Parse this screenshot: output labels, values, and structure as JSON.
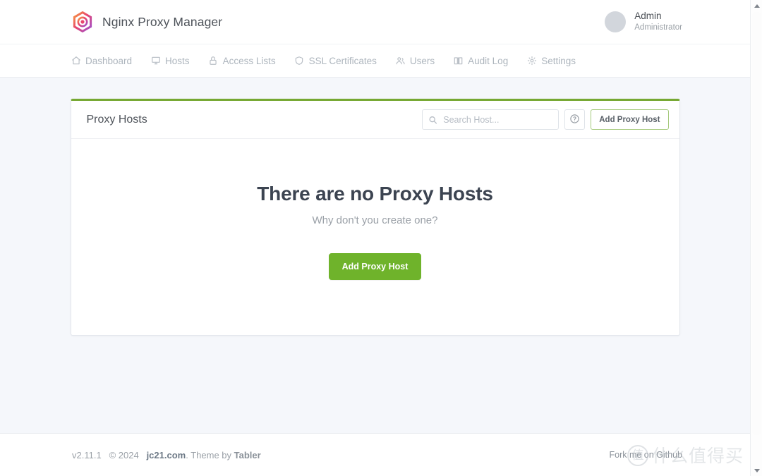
{
  "header": {
    "brand_title": "Nginx Proxy Manager",
    "logo_icon": "hexagon-target-logo",
    "user": {
      "name": "Admin",
      "role": "Administrator",
      "avatar_icon": "avatar"
    }
  },
  "nav": {
    "items": [
      {
        "label": "Dashboard",
        "icon": "home-icon"
      },
      {
        "label": "Hosts",
        "icon": "monitor-icon"
      },
      {
        "label": "Access Lists",
        "icon": "lock-icon"
      },
      {
        "label": "SSL Certificates",
        "icon": "shield-icon"
      },
      {
        "label": "Users",
        "icon": "users-icon"
      },
      {
        "label": "Audit Log",
        "icon": "book-icon"
      },
      {
        "label": "Settings",
        "icon": "gear-icon"
      }
    ]
  },
  "card": {
    "title": "Proxy Hosts",
    "accent_color": "#76a832",
    "search": {
      "placeholder": "Search Host...",
      "value": "",
      "icon": "search-icon"
    },
    "help_button": {
      "icon": "question-circle-icon",
      "label": "?"
    },
    "add_button_header": "Add Proxy Host",
    "empty_state": {
      "title": "There are no Proxy Hosts",
      "subtitle": "Why don't you create one?",
      "cta_label": "Add Proxy Host",
      "cta_color": "#6fb32b"
    }
  },
  "footer": {
    "version": "v2.11.1",
    "copyright": "© 2024",
    "site_link": "jc21.com",
    "theme_prefix": ". Theme by ",
    "theme_link": "Tabler",
    "fork_text": "Fork me on Github"
  },
  "watermark": {
    "badge_char": "值",
    "text": "什么值得买"
  },
  "scrollbar": {
    "up_arrow": "scroll-up-arrow",
    "down_arrow": "scroll-down-arrow"
  }
}
